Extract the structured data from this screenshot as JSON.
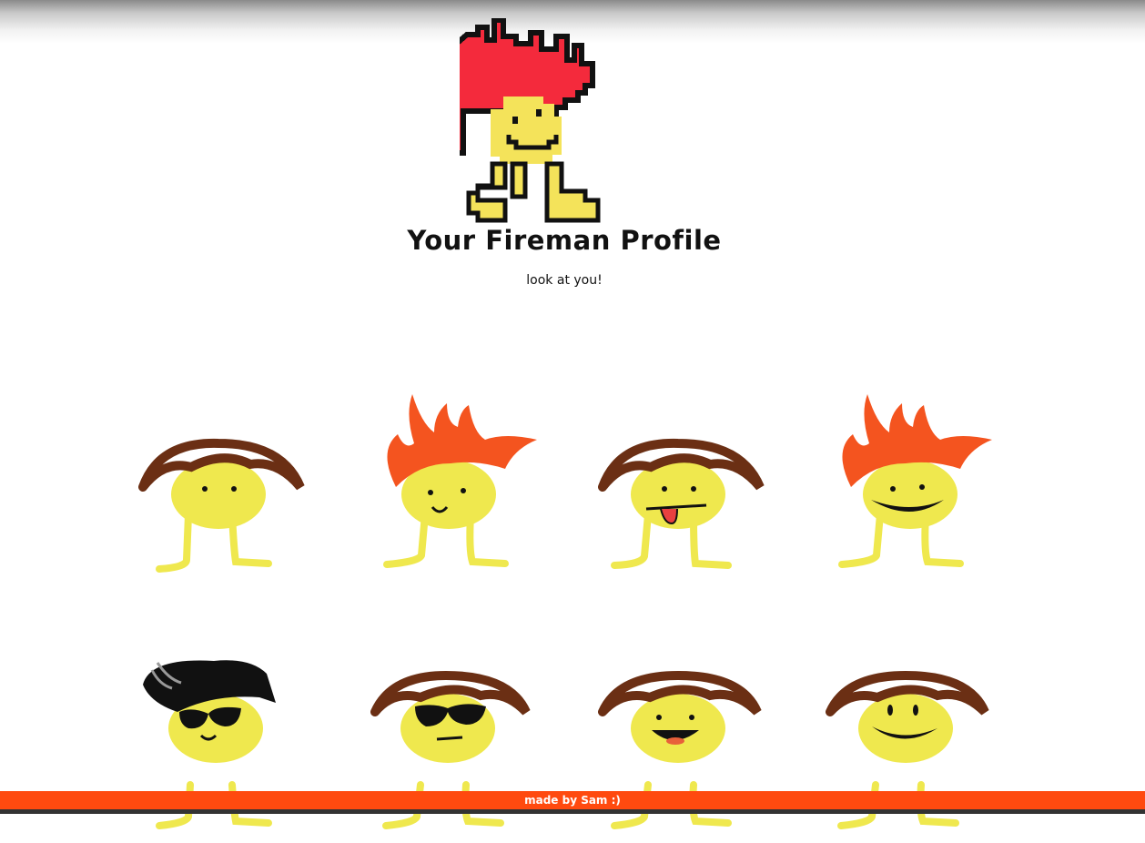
{
  "header": {
    "title": "Your Fireman Profile",
    "subtitle": "look at you!"
  },
  "logo": {
    "icon": "pixel-fireman-logo",
    "flame_color": "#f42a3c",
    "body_color": "#f4e35a"
  },
  "avatars": [
    {
      "hair": "brown-shaggy",
      "face": "neutral-eyes"
    },
    {
      "hair": "orange-flame",
      "face": "small-smile"
    },
    {
      "hair": "brown-shaggy",
      "face": "tongue-out"
    },
    {
      "hair": "orange-flame",
      "face": "big-grin"
    },
    {
      "hair": "black-cap",
      "face": "sunglasses-smile"
    },
    {
      "hair": "brown-shaggy",
      "face": "sunglasses-flat"
    },
    {
      "hair": "brown-shaggy",
      "face": "open-mouth-tongue"
    },
    {
      "hair": "brown-shaggy",
      "face": "big-smile"
    }
  ],
  "colors": {
    "body": "#efe84e",
    "hair_brown": "#6b2f14",
    "flame_orange": "#f4541f",
    "footer_bg": "#ff4a0f"
  },
  "footer": {
    "text": "made by Sam :)"
  }
}
